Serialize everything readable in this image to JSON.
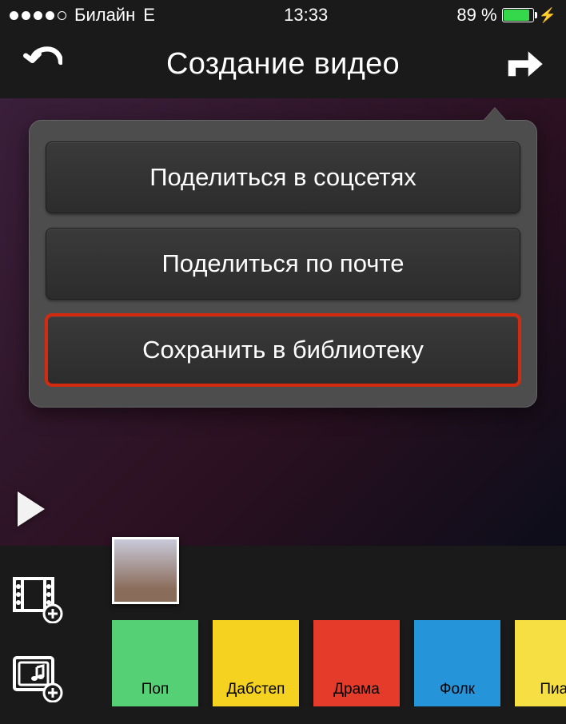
{
  "status": {
    "carrier": "Билайн",
    "network": "E",
    "time": "13:33",
    "battery_text": "89 %",
    "battery_percent": 89
  },
  "nav": {
    "title": "Создание видео"
  },
  "popover": {
    "options": [
      {
        "label": "Поделиться в соцсетях",
        "highlight": false
      },
      {
        "label": "Поделиться по почте",
        "highlight": false
      },
      {
        "label": "Сохранить в библиотеку",
        "highlight": true
      }
    ]
  },
  "audio_tiles": [
    {
      "label": "Поп",
      "color": "#56d074"
    },
    {
      "label": "Дабстеп",
      "color": "#f4d21f"
    },
    {
      "label": "Драма",
      "color": "#e53b2a"
    },
    {
      "label": "Фолк",
      "color": "#2694d9"
    },
    {
      "label": "Пиан",
      "color": "#f5df42"
    }
  ],
  "icons": {
    "back": "back-undo-icon",
    "share": "share-icon",
    "video": "add-video-icon",
    "music": "add-music-icon",
    "play": "play-icon"
  }
}
